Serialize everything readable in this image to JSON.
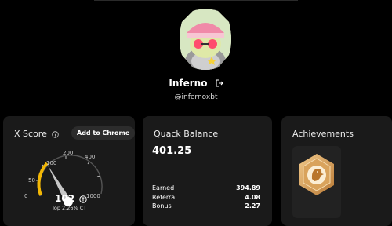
{
  "profile": {
    "username": "Inferno",
    "handle": "@infernoxbt"
  },
  "x_score": {
    "title": "X Score",
    "chrome_button": "Add to Chrome",
    "score": "102",
    "rank_text": "Top 2.26% CT",
    "gauge_ticks": [
      "0",
      "50",
      "100",
      "200",
      "400",
      "1000"
    ],
    "gauge_level_fraction": 0.2
  },
  "quack": {
    "title": "Quack Balance",
    "balance": "401.25",
    "rows": [
      {
        "label": "Earned",
        "value": "394.89"
      },
      {
        "label": "Referral",
        "value": "4.08"
      },
      {
        "label": "Bonus",
        "value": "2.27"
      }
    ]
  },
  "achievements": {
    "title": "Achievements"
  },
  "colors": {
    "background": "#000000",
    "card": "#1a1a1a",
    "gauge_accent": "#f2b705",
    "badge_gold": "#d9a35c"
  },
  "icons": {
    "logout": "logout-icon",
    "info": "info-icon",
    "coin": "coin-icon",
    "badge": "duck-badge-icon"
  }
}
